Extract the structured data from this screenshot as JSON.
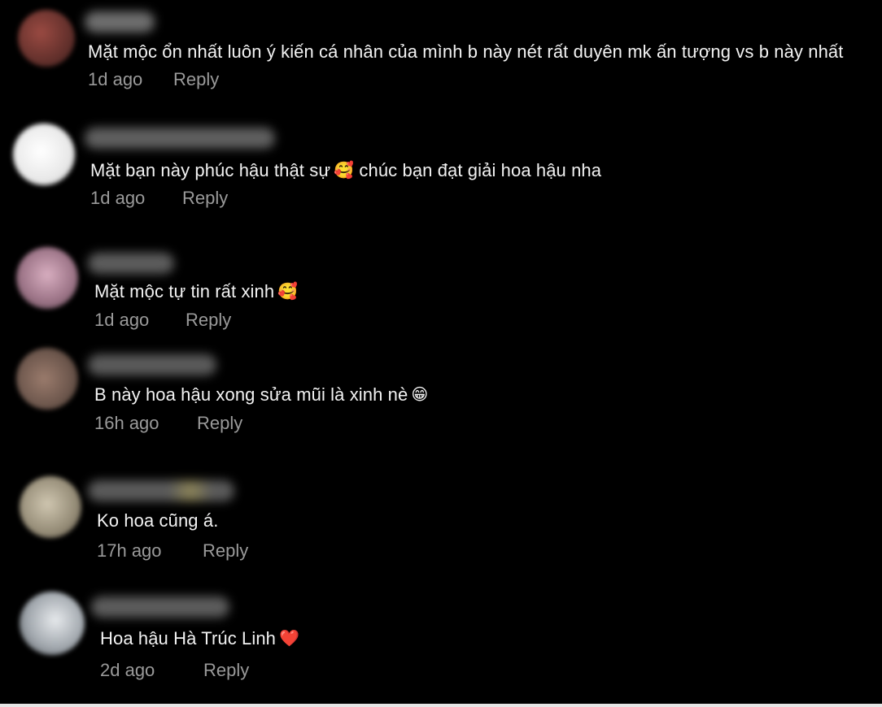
{
  "comments": [
    {
      "avatar_color": "#7a3b35",
      "text": "Mặt mộc ổn nhất luôn ý kiến cá nhân của mình b này nét rất duyên mk ấn tượng vs b này nhất",
      "emoji": "",
      "time": "1d ago",
      "reply_label": "Reply"
    },
    {
      "avatar_color": "#f2f2f2",
      "text": "Mặt bạn này phúc hậu thật sự",
      "emoji": "🥰",
      "text_after": "chúc bạn đạt giải hoa hậu nha",
      "time": "1d ago",
      "reply_label": "Reply"
    },
    {
      "avatar_color": "#a98294",
      "text": "Mặt mộc tự tin rất xinh",
      "emoji": "🥰",
      "time": "1d ago",
      "reply_label": "Reply"
    },
    {
      "avatar_color": "#7a6258",
      "text": "B này hoa hậu xong sửa mũi là xinh nè",
      "emoji": "😁",
      "time": "16h ago",
      "reply_label": "Reply"
    },
    {
      "avatar_color": "#a59b86",
      "text": "Ko hoa cũng á.",
      "emoji": "",
      "time": "17h ago",
      "reply_label": "Reply"
    },
    {
      "avatar_color": "#b7bcc2",
      "text": "Hoa hậu Hà Trúc Linh",
      "emoji": "❤️",
      "time": "2d ago",
      "reply_label": "Reply"
    }
  ]
}
